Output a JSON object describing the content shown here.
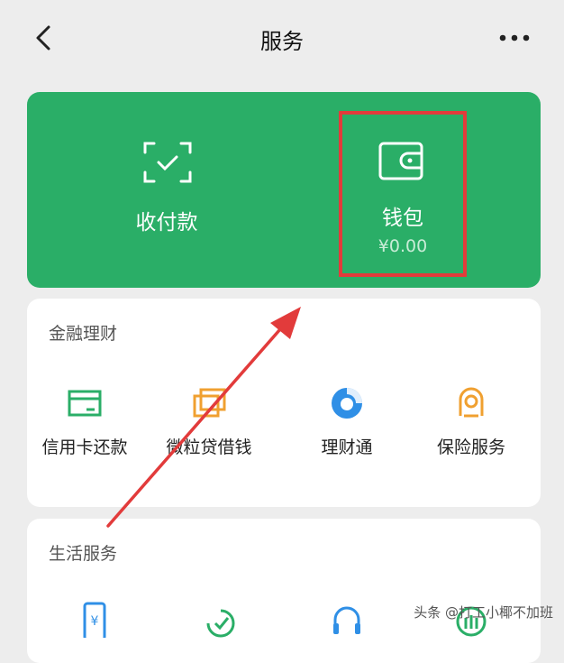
{
  "header": {
    "title": "服务"
  },
  "green_card": {
    "pay": {
      "label": "收付款"
    },
    "wallet": {
      "label": "钱包",
      "balance": "¥0.00"
    }
  },
  "finance": {
    "title": "金融理财",
    "items": [
      {
        "label": "信用卡还款",
        "icon": "credit-card-icon"
      },
      {
        "label": "微粒贷借钱",
        "icon": "loan-cards-icon"
      },
      {
        "label": "理财通",
        "icon": "wealth-icon"
      },
      {
        "label": "保险服务",
        "icon": "insurance-icon"
      }
    ]
  },
  "life": {
    "title": "生活服务",
    "items": [
      {
        "icon": "phone-recharge-icon"
      },
      {
        "icon": "check-leaf-icon"
      },
      {
        "icon": "headset-icon"
      },
      {
        "icon": "utility-icon"
      }
    ]
  },
  "watermark": "头条 @打工小椰不加班",
  "colors": {
    "brand_green": "#2aae67",
    "highlight_red": "#e23b3b",
    "finance_green": "#2aae67",
    "finance_orange": "#f0a030",
    "finance_blue": "#2f8fe6"
  }
}
